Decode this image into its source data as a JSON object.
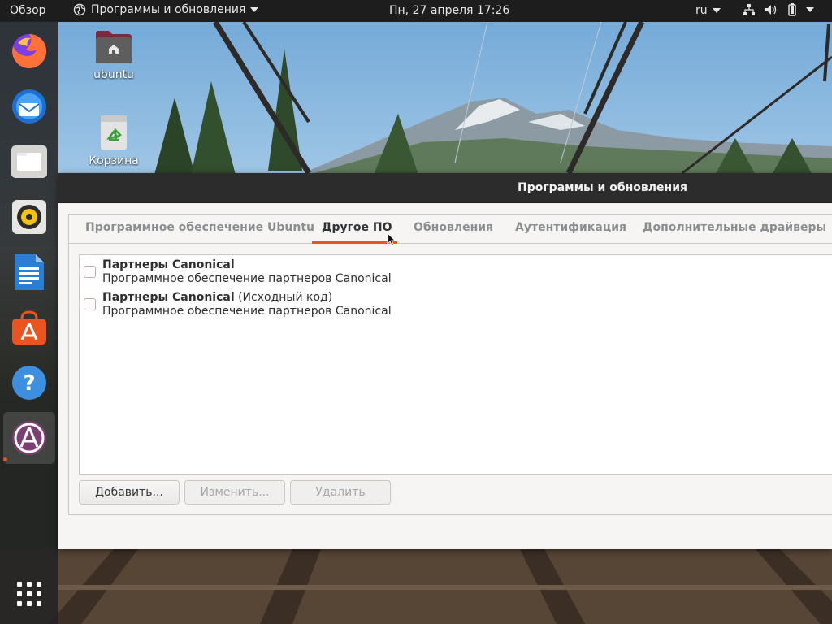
{
  "topbar": {
    "overview_label": "Обзор",
    "app_menu_label": "Программы и обновления",
    "clock": "Пн, 27 апреля  17:26",
    "language": "ru",
    "tray_icons": [
      "network-icon",
      "volume-icon",
      "battery-icon",
      "system-menu-caret"
    ]
  },
  "dock": {
    "items": [
      {
        "name": "firefox",
        "icon": "firefox-icon"
      },
      {
        "name": "thunderbird",
        "icon": "thunderbird-icon"
      },
      {
        "name": "files",
        "icon": "files-icon"
      },
      {
        "name": "rhythmbox",
        "icon": "rhythmbox-icon"
      },
      {
        "name": "libreoffice-writer",
        "icon": "writer-icon"
      },
      {
        "name": "ubuntu-software",
        "icon": "software-icon"
      },
      {
        "name": "help",
        "icon": "help-icon"
      },
      {
        "name": "software-properties",
        "icon": "software-properties-icon",
        "active": true
      }
    ],
    "show_apps_icon": "show-apps-grid-icon"
  },
  "desktop": {
    "home_label": "ubuntu",
    "trash_label": "Корзина"
  },
  "window": {
    "title": "Программы и обновления",
    "tabs": [
      {
        "label": "Программное обеспечение Ubuntu",
        "active": false
      },
      {
        "label": "Другое ПО",
        "active": true
      },
      {
        "label": "Обновления",
        "active": false
      },
      {
        "label": "Аутентификация",
        "active": false
      },
      {
        "label": "Дополнительные драйверы",
        "active": false
      }
    ],
    "sources": [
      {
        "title": "Партнеры Canonical",
        "suffix": "",
        "description": "Программное обеспечение партнеров Canonical",
        "checked": false
      },
      {
        "title": "Партнеры Canonical",
        "suffix": " (Исходный код)",
        "description": "Программное обеспечение партнеров Canonical",
        "checked": false
      }
    ],
    "buttons": {
      "add": "Добавить...",
      "edit": "Изменить...",
      "remove": "Удалить"
    }
  },
  "colors": {
    "accent": "#e95420",
    "topbar": "#1d1d1d",
    "titlebar": "#2c2c2c"
  }
}
